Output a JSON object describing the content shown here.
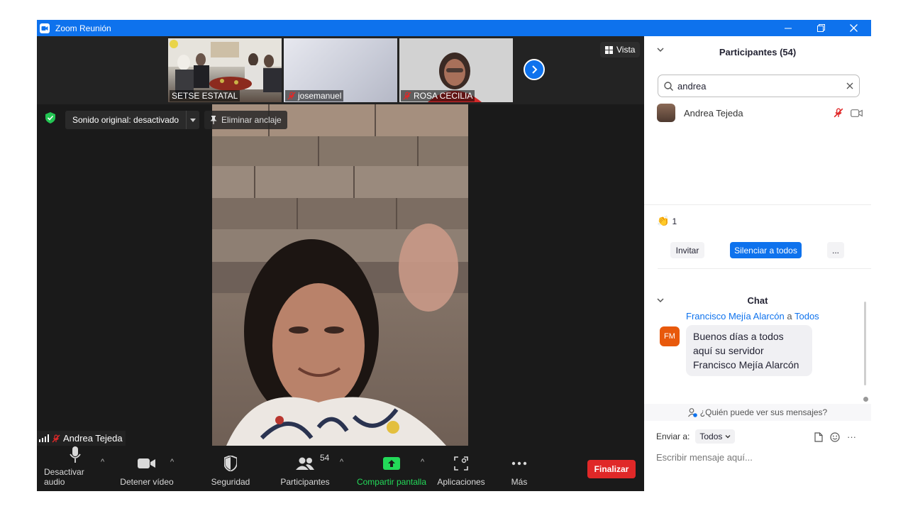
{
  "window": {
    "title": "Zoom Reunión"
  },
  "strip": {
    "thumbnails": [
      {
        "name": "SETSE ESTATAL",
        "muted": false
      },
      {
        "name": "josemanuel",
        "muted": true
      },
      {
        "name": "ROSA CECILIA",
        "muted": true
      }
    ],
    "view_label": "Vista"
  },
  "video": {
    "sound_label": "Sonido original: desactivado",
    "unpin_label": "Eliminar anclaje",
    "speaker_name": "Andrea Tejeda"
  },
  "toolbar": {
    "audio_label": "Desactivar audio",
    "video_label": "Detener vídeo",
    "security_label": "Seguridad",
    "participants_label": "Participantes",
    "participants_count": "54",
    "share_label": "Compartir pantalla",
    "apps_label": "Aplicaciones",
    "more_label": "Más",
    "end_label": "Finalizar"
  },
  "participants": {
    "title": "Participantes (54)",
    "search_value": "andrea",
    "list": [
      {
        "name": "Andrea Tejeda"
      }
    ],
    "reactions_count": "1",
    "invite_label": "Invitar",
    "mute_all_label": "Silenciar a todos",
    "more_label": "..."
  },
  "chat": {
    "title": "Chat",
    "messages": [
      {
        "sender": "Francisco Mejía Alarcón",
        "connector": "a",
        "recipient": "Todos",
        "initials": "FM",
        "lines": [
          "Buenos días a todos",
          "aquí su servidor",
          "Francisco Mejía Alarcón"
        ]
      }
    ],
    "who_sees": "¿Quién puede ver sus mensajes?",
    "send_to_label": "Enviar a:",
    "send_to_value": "Todos",
    "more_label": "···",
    "placeholder": "Escribir mensaje aquí..."
  },
  "colors": {
    "accent": "#0e72ed",
    "end": "#e02828",
    "share": "#23d959",
    "toolbar_bg": "#1a1a1a"
  }
}
